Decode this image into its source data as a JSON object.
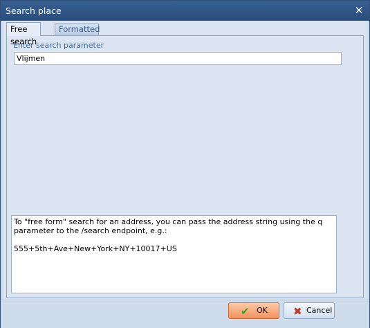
{
  "window": {
    "title": "Search place"
  },
  "tabs": [
    {
      "label": "Free search",
      "active": true
    },
    {
      "label": "Formatted",
      "active": false
    }
  ],
  "search": {
    "label": "Enter search parameter",
    "value": "Vlijmen"
  },
  "help": {
    "text": "To \"free form\" search for an address, you can pass the address string using the q parameter to the /search endpoint, e.g.:",
    "example": "555+5th+Ave+New+York+NY+10017+US"
  },
  "buttons": {
    "ok_label": "OK",
    "cancel_label": "Cancel"
  },
  "icons": {
    "close": "close-icon",
    "ok": "check-icon",
    "cancel": "cross-icon"
  },
  "colors": {
    "title_bar": "#2f5887",
    "ok_button": "#f3925e",
    "label_text": "#3b6aa0"
  }
}
